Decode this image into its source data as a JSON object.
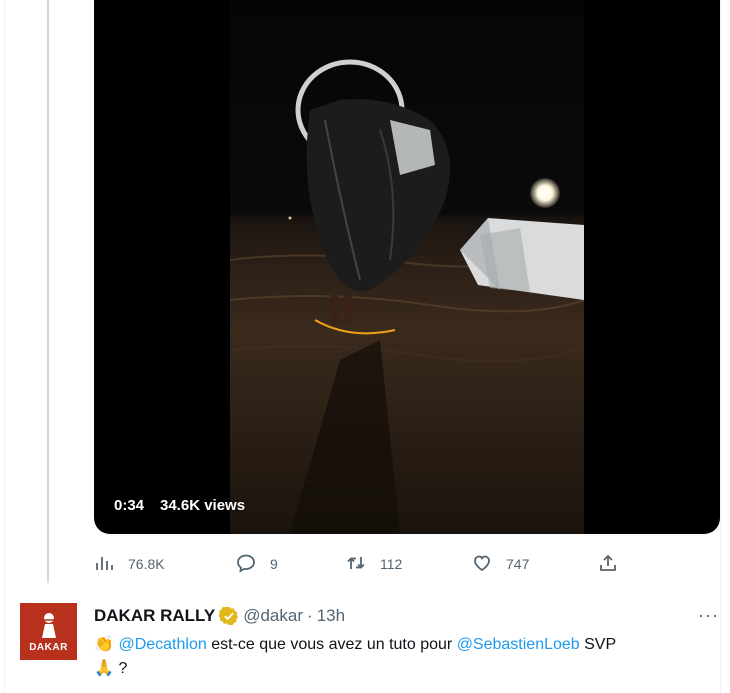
{
  "video": {
    "duration": "0:34",
    "views": "34.6K views"
  },
  "actions": {
    "analytics_count": "76.8K",
    "reply_count": "9",
    "retweet_count": "112",
    "like_count": "747"
  },
  "reply_tweet": {
    "display_name": "DAKAR RALLY",
    "handle": "@dakar",
    "separator": "·",
    "time": "13h",
    "more": "···",
    "avatar_text": "DAKAR",
    "text_emoji_1": "👏",
    "mention_1": "@Decathlon",
    "text_part_1": " est-ce que vous avez un tuto pour ",
    "mention_2": "@SebastienLoeb",
    "text_part_2": " SVP",
    "text_emoji_2": "🙏",
    "text_part_3": " ?"
  },
  "colors": {
    "accent": "#1d9bf0",
    "muted": "#536471",
    "verified": "#e2b719",
    "avatar_bg": "#b8311d"
  }
}
